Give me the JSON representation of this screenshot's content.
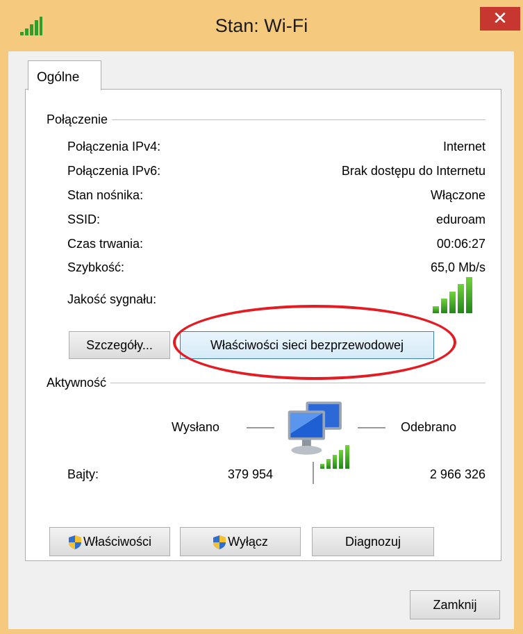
{
  "window": {
    "title": "Stan: Wi-Fi",
    "close_symbol": "✕"
  },
  "tabs": [
    {
      "label": "Ogólne"
    }
  ],
  "connection": {
    "header": "Połączenie",
    "rows": [
      {
        "label": "Połączenia IPv4:",
        "value": "Internet"
      },
      {
        "label": "Połączenia IPv6:",
        "value": "Brak dostępu do Internetu"
      },
      {
        "label": "Stan nośnika:",
        "value": "Włączone"
      },
      {
        "label": "SSID:",
        "value": "eduroam"
      },
      {
        "label": "Czas trwania:",
        "value": "00:06:27"
      },
      {
        "label": "Szybkość:",
        "value": "65,0 Mb/s"
      }
    ],
    "signal_label": "Jakość sygnału:",
    "signal_bars_lit": 5,
    "signal_bars_total": 5,
    "details_button": "Szczegóły...",
    "wireless_props_button": "Właściwości sieci bezprzewodowej"
  },
  "activity": {
    "header": "Aktywność",
    "sent_label": "Wysłano",
    "received_label": "Odebrano",
    "bytes_label": "Bajty:",
    "bytes_sent": "379 954",
    "bytes_received": "2 966 326"
  },
  "actions": {
    "properties": "Właściwości",
    "disable": "Wyłącz",
    "diagnose": "Diagnozuj"
  },
  "footer": {
    "close_button": "Zamknij"
  },
  "icons": {
    "title": "wifi-signal-icon",
    "network": "network-computers-icon",
    "shield": "uac-shield-icon"
  },
  "colors": {
    "frame": "#f5ca7e",
    "close_button": "#c7372f",
    "annotation": "#e31b23",
    "signal": "#3aa829"
  }
}
